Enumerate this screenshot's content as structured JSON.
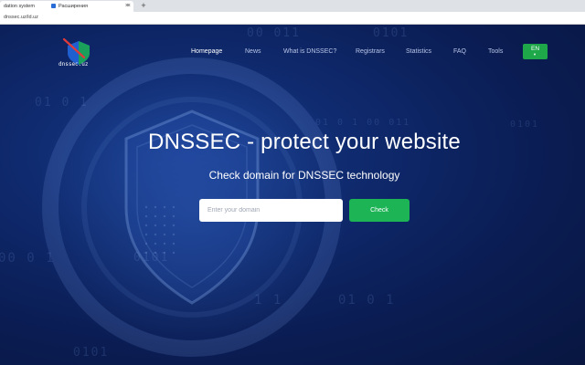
{
  "browser": {
    "tabs": [
      {
        "label": "dation system",
        "active": true
      },
      {
        "label": "Расширения",
        "active": false
      }
    ],
    "new_tab_symbol": "+",
    "close_symbol": "×",
    "address": "dnssec.uz/ld.uz"
  },
  "site": {
    "logo_text": "dnssec.uz",
    "nav": [
      "Homepage",
      "News",
      "What is DNSSEC?",
      "Registrars",
      "Statistics",
      "FAQ",
      "Tools"
    ],
    "language": "EN",
    "language_caret": "▼",
    "colors": {
      "accent": "#1db456",
      "background": "#0a1c52",
      "lang_button": "#1ea84a"
    }
  },
  "hero": {
    "title": "DNSSEC - protect your website",
    "subtitle": "Check domain for DNSSEC technology",
    "input_placeholder": "Enter your domain",
    "button_label": "Check"
  }
}
